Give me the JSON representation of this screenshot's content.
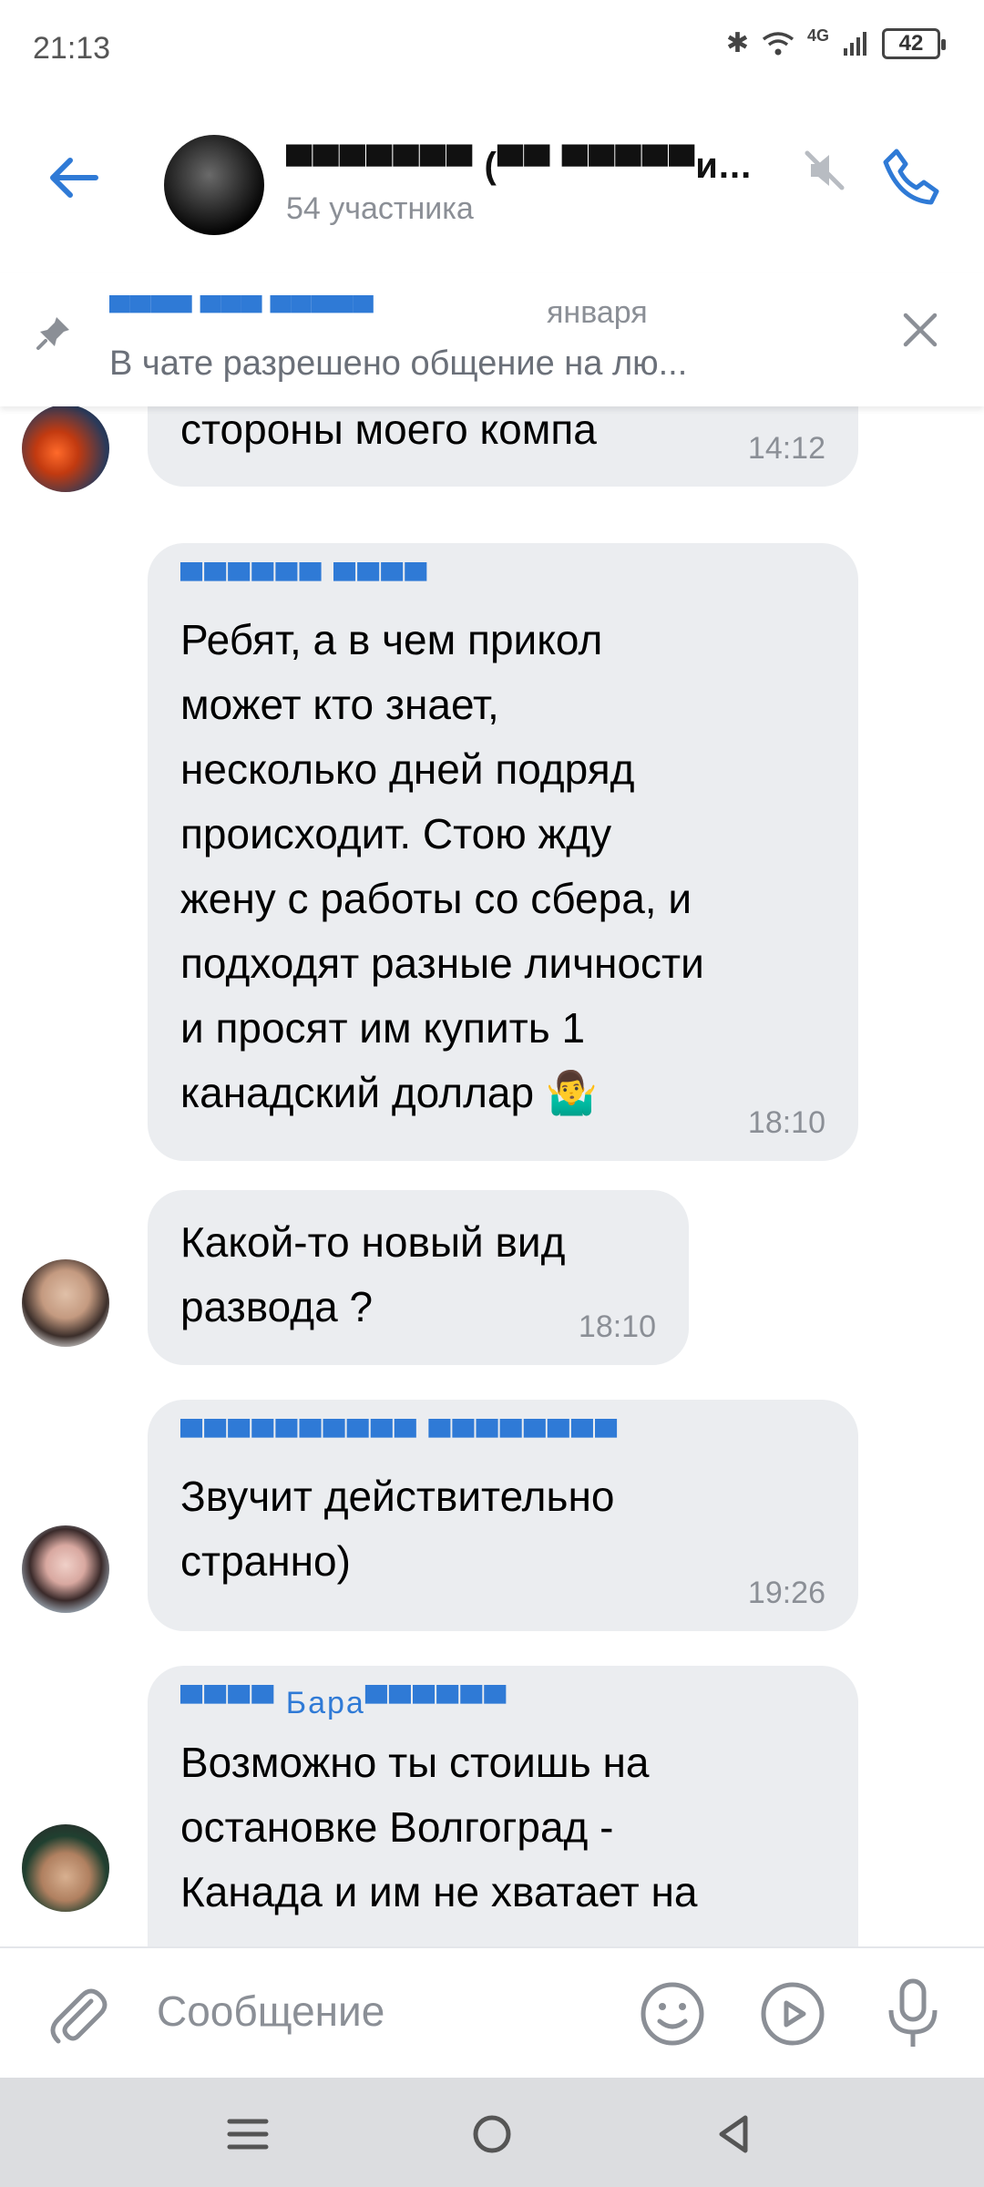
{
  "status_bar": {
    "time": "21:13",
    "network": "4G",
    "battery": "42"
  },
  "header": {
    "title": "▀▀▀▀▀▀▀ (▀▀ ▀▀▀▀▀и...",
    "subtitle": "54 участника"
  },
  "pinned": {
    "author": "▀▀▀▀ ▀▀▀ ▀▀▀▀▀",
    "date": "января",
    "text": "В чате разрешено общение на лю..."
  },
  "messages": [
    {
      "sender": "",
      "text": "стороны моего компа",
      "time": "14:12"
    },
    {
      "sender": "▀▀▀▀▀▀ ▀▀▀▀",
      "text": "Ребят, а в чем прикол\nможет кто знает,\nнесколько дней подряд\nпроисходит. Стою жду\nжену с работы со сбера, и\nподходят разные личности\nи просят им купить 1\nканадский доллар 🤷‍♂️",
      "time": "18:10"
    },
    {
      "sender": "",
      "text": "Какой-то новый вид\nразвода ?",
      "time": "18:10"
    },
    {
      "sender": "▀▀▀▀▀▀▀▀▀▀ ▀▀▀▀▀▀▀▀",
      "text": "Звучит действительно\nстранно)",
      "time": "19:26"
    },
    {
      "sender": "▀▀▀▀ Бара▀▀▀▀▀▀",
      "text": "Возможно ты стоишь на\nостановке Волгоград -\nКанада и им не хватает на",
      "time": ""
    }
  ],
  "composer": {
    "placeholder": "Сообщение"
  },
  "colors": {
    "accent": "#2f7ad6",
    "bubble": "#ebedf0",
    "muted": "#8b8f96"
  },
  "icons": [
    "back-arrow-icon",
    "mute-icon",
    "phone-icon",
    "pin-icon",
    "close-icon",
    "attach-icon",
    "emoji-icon",
    "video-message-icon",
    "microphone-icon",
    "menu-icon",
    "home-icon",
    "back-icon"
  ]
}
